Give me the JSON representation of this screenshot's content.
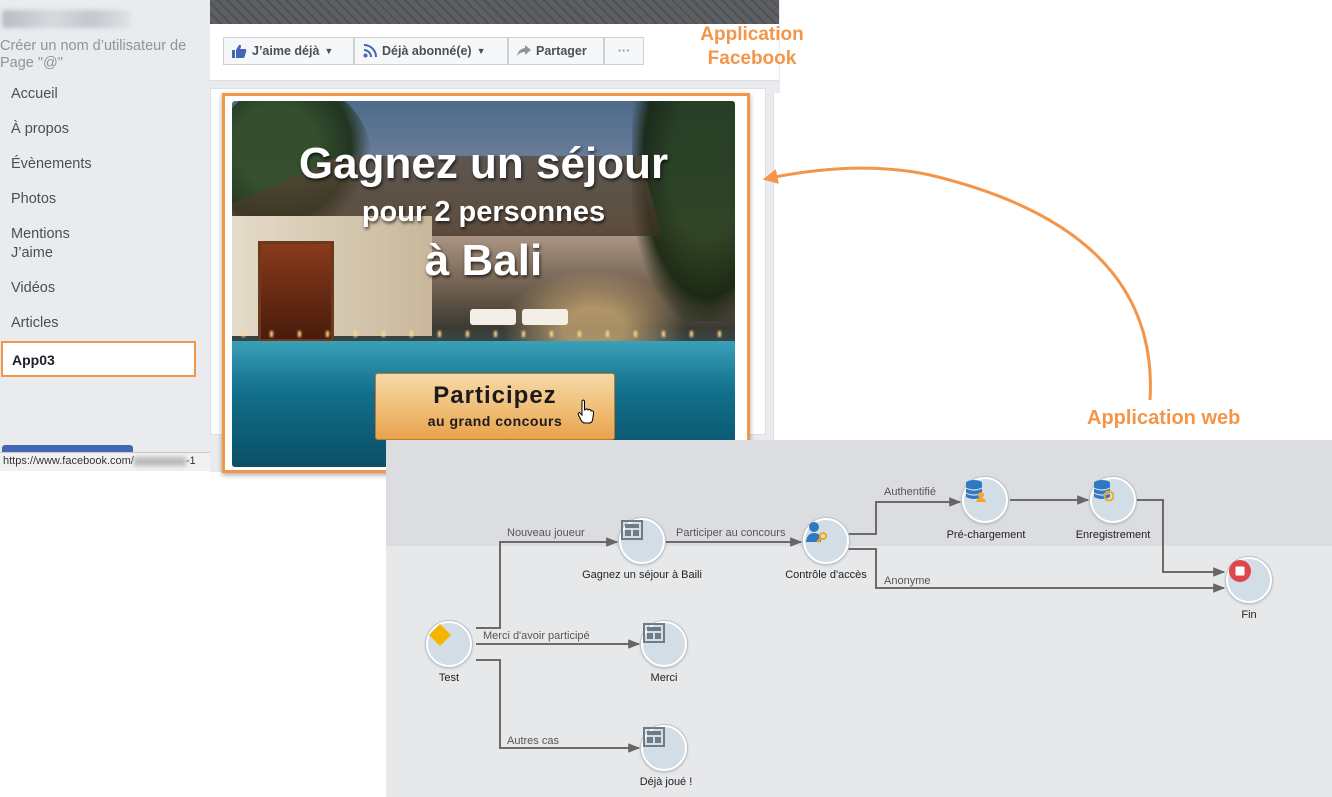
{
  "facebook": {
    "sidebar": {
      "create_username": "Créer un nom d’utilisateur de Page \"@\"",
      "items": [
        {
          "label": "Accueil"
        },
        {
          "label": "À propos"
        },
        {
          "label": "Évènements"
        },
        {
          "label": "Photos"
        },
        {
          "label": "Mentions J’aime"
        },
        {
          "label": "Vidéos"
        },
        {
          "label": "Articles"
        },
        {
          "label": "App03",
          "active": true
        }
      ]
    },
    "status_bar": {
      "url_prefix": "https://www.facebook.com/",
      "url_suffix": "-1"
    },
    "actions": {
      "like": "J’aime déjà",
      "follow": "Déjà abonné(e)",
      "share": "Partager",
      "more": "···"
    },
    "banner": {
      "title": "Gagnez un séjour",
      "subtitle": "pour 2 personnes",
      "destination": "à Bali",
      "cta_main": "Participez",
      "cta_sub": "au grand concours"
    }
  },
  "labels": {
    "facebook_app_line1": "Application",
    "facebook_app_line2": "Facebook",
    "web_app": "Application web"
  },
  "workflow": {
    "nodes": {
      "test": "Test",
      "gagnez": "Gagnez un séjour à Baili",
      "merci": "Merci",
      "deja": "Déjà joué !",
      "controle": "Contrôle d'accès",
      "prechargement": "Pré-chargement",
      "enregistrement": "Enregistrement",
      "fin": "Fin"
    },
    "edges": {
      "nouveau_joueur": "Nouveau joueur",
      "merci_participe": "Merci d'avoir participé",
      "autres_cas": "Autres cas",
      "participer": "Participer au concours",
      "authentifie": "Authentifié",
      "anonyme": "Anonyme"
    }
  },
  "colors": {
    "accent": "#f3964a",
    "facebook_blue": "#4267b2",
    "node_fill": "#d3dde6",
    "test_diamond": "#f5b400",
    "fin_stop": "#e0474c"
  }
}
